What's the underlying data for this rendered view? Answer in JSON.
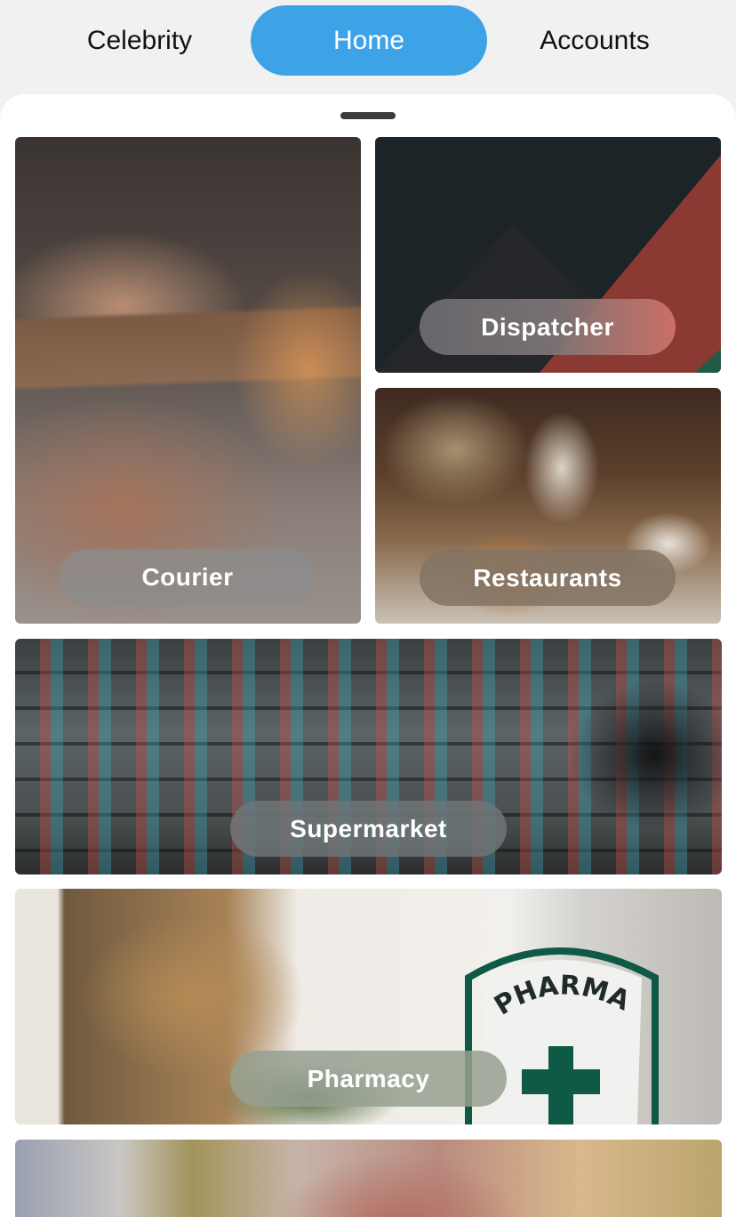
{
  "tabs": {
    "celebrity": "Celebrity",
    "home": "Home",
    "accounts": "Accounts",
    "active": "Home",
    "active_color": "#3ea3e6"
  },
  "tiles": {
    "courier": "Courier",
    "dispatcher": "Dispatcher",
    "restaurants": "Restaurants",
    "supermarket": "Supermarket",
    "pharmacy": "Pharmacy",
    "pharmacy_sign_text": "PHARMACY"
  },
  "colors": {
    "background": "#f1f1f1",
    "sheet": "#ffffff",
    "dispatcher_dark": "#1d2428",
    "dispatcher_red": "#8b3a33",
    "pharmacy_green": "#0e5a46"
  }
}
